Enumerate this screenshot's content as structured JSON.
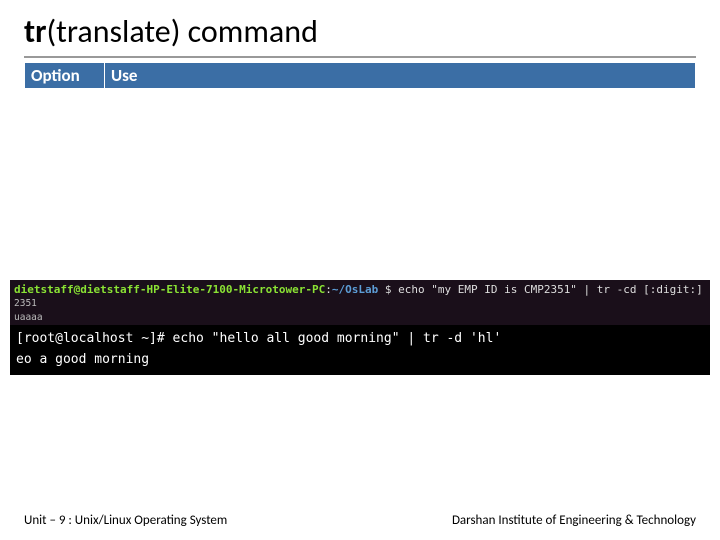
{
  "title": {
    "cmd": "tr",
    "rest": "(translate) command"
  },
  "table": {
    "header": {
      "option": "Option",
      "use": "Use"
    }
  },
  "terminal1": {
    "userhost": "dietstaff@dietstaff-HP-Elite-7100-Microtower-PC",
    "sep": ":",
    "path": "~/OsLab",
    "prompt": "$",
    "cmd": "echo \"my EMP ID is CMP2351\" | tr -cd [:digit:]",
    "out1": "2351",
    "out2": "uaaaa"
  },
  "terminal2": {
    "prompt": "[root@localhost ~]#",
    "cmd": "echo \"hello all good morning\" | tr -d 'hl'",
    "out": "eo a good morning"
  },
  "footer": {
    "left": "Unit – 9  : Unix/Linux Operating System",
    "right": "Darshan Institute of Engineering & Technology"
  }
}
